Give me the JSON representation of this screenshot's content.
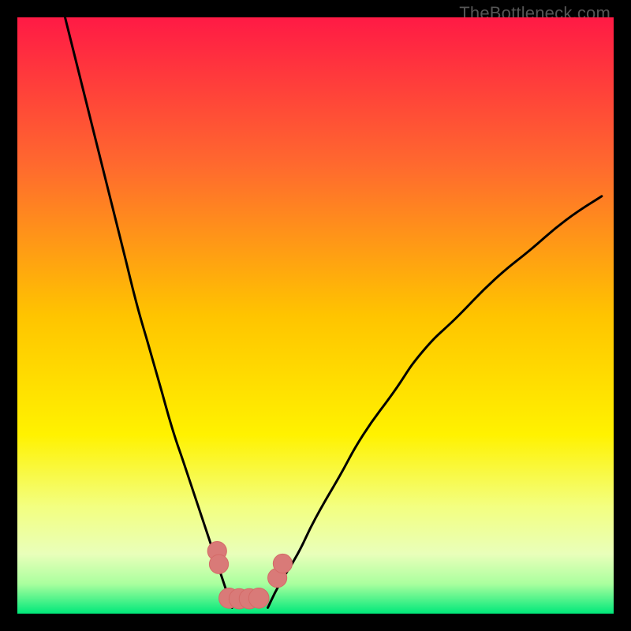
{
  "watermark": "TheBottleneck.com",
  "colors": {
    "gradient_top": "#ff1a45",
    "gradient_upper_mid": "#ff7a2a",
    "gradient_mid": "#ffd400",
    "gradient_lower_mid": "#f2ff66",
    "gradient_band": "#ecffb0",
    "gradient_bottom": "#00e87a",
    "curve": "#000000",
    "blob": "#d97a78",
    "blob_outline": "#d46a67"
  },
  "chart_data": {
    "type": "line",
    "title": "",
    "xlabel": "",
    "ylabel": "",
    "xlim": [
      0,
      100
    ],
    "ylim": [
      0,
      100
    ],
    "series": [
      {
        "name": "left-curve",
        "x": [
          8,
          10,
          12,
          14,
          16,
          18,
          20,
          22,
          24,
          26,
          28,
          30,
          32,
          33,
          34,
          35,
          36
        ],
        "y": [
          100,
          92,
          84,
          76,
          68,
          60,
          52,
          45,
          38,
          31,
          25,
          19,
          13,
          10,
          7,
          4,
          1
        ]
      },
      {
        "name": "right-curve",
        "x": [
          42,
          44,
          47,
          50,
          54,
          58,
          63,
          68,
          74,
          80,
          86,
          92,
          98
        ],
        "y": [
          1,
          5,
          10,
          16,
          23,
          30,
          37,
          44,
          50,
          56,
          61,
          66,
          70
        ]
      }
    ],
    "annotations": [
      {
        "shape": "blob",
        "cx": 33.5,
        "cy": 10.5,
        "r": 1.6
      },
      {
        "shape": "blob",
        "cx": 33.8,
        "cy": 8.3,
        "r": 1.6
      },
      {
        "shape": "blob",
        "cx": 35.5,
        "cy": 2.6,
        "r": 1.7
      },
      {
        "shape": "blob",
        "cx": 37.2,
        "cy": 2.5,
        "r": 1.7
      },
      {
        "shape": "blob",
        "cx": 38.9,
        "cy": 2.5,
        "r": 1.7
      },
      {
        "shape": "blob",
        "cx": 40.5,
        "cy": 2.6,
        "r": 1.7
      },
      {
        "shape": "blob",
        "cx": 43.6,
        "cy": 6.0,
        "r": 1.6
      },
      {
        "shape": "blob",
        "cx": 44.5,
        "cy": 8.4,
        "r": 1.6
      }
    ],
    "background_gradient": {
      "type": "vertical",
      "stops": [
        {
          "offset": 0.0,
          "color": "#ff1a45"
        },
        {
          "offset": 0.25,
          "color": "#ff6a2e"
        },
        {
          "offset": 0.5,
          "color": "#ffc400"
        },
        {
          "offset": 0.7,
          "color": "#fff200"
        },
        {
          "offset": 0.82,
          "color": "#f3ff80"
        },
        {
          "offset": 0.9,
          "color": "#e9ffba"
        },
        {
          "offset": 0.95,
          "color": "#aaff9e"
        },
        {
          "offset": 1.0,
          "color": "#00e87a"
        }
      ]
    }
  }
}
